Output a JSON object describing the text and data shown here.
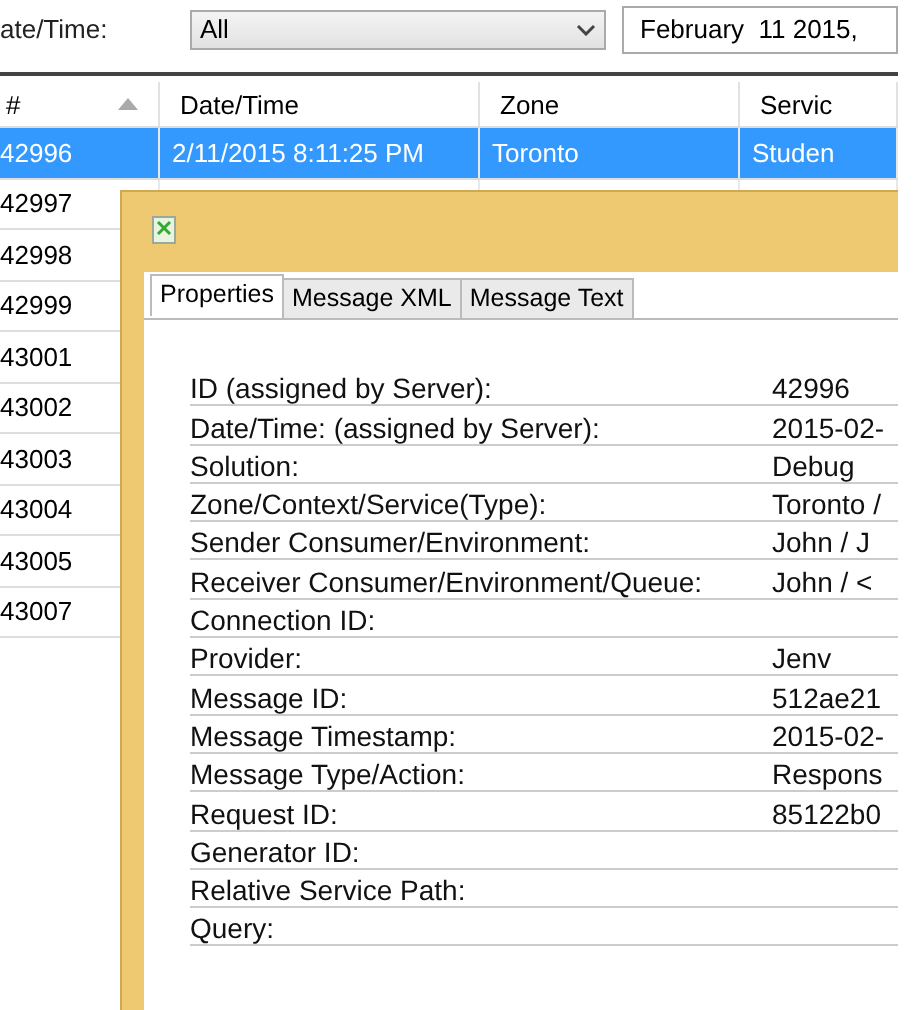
{
  "filter": {
    "label": "ate/Time:",
    "dropdown": "All",
    "date": "February  11 2015,"
  },
  "table": {
    "columns": [
      {
        "label": "#",
        "sorted": true
      },
      {
        "label": "Date/Time",
        "sorted": false
      },
      {
        "label": "Zone",
        "sorted": false
      },
      {
        "label": "Servic",
        "sorted": false
      }
    ],
    "rows": [
      {
        "cells": [
          "42996",
          "2/11/2015 8:11:25 PM",
          "Toronto",
          "Studen"
        ],
        "selected": true
      },
      {
        "cells": [
          "42997"
        ],
        "selected": false
      },
      {
        "cells": [
          "42998"
        ],
        "selected": false
      },
      {
        "cells": [
          "42999"
        ],
        "selected": false
      },
      {
        "cells": [
          "43001"
        ],
        "selected": false
      },
      {
        "cells": [
          "43002"
        ],
        "selected": false
      },
      {
        "cells": [
          "43003"
        ],
        "selected": false
      },
      {
        "cells": [
          "43004"
        ],
        "selected": false
      },
      {
        "cells": [
          "43005"
        ],
        "selected": false
      },
      {
        "cells": [
          "43007"
        ],
        "selected": false
      }
    ]
  },
  "dialog": {
    "tabs": [
      {
        "label": "Properties",
        "selected": true
      },
      {
        "label": "Message XML",
        "selected": false
      },
      {
        "label": "Message Text",
        "selected": false
      }
    ],
    "properties": [
      {
        "label": "ID (assigned by Server):",
        "value": "42996"
      },
      {
        "label": "Date/Time: (assigned by Server):",
        "value": "2015-02-"
      },
      {
        "label": "Solution:",
        "value": "Debug"
      },
      {
        "label": "Zone/Context/Service(Type):",
        "value": "Toronto /"
      },
      {
        "label": "Sender Consumer/Environment:",
        "value": "John / J"
      },
      {
        "label": "Receiver Consumer/Environment/Queue:",
        "value": "John / <"
      },
      {
        "label": "Connection ID:"
      },
      {
        "label": "Provider:",
        "value": "Jenv"
      },
      {
        "label": "Message ID:",
        "value": "512ae21"
      },
      {
        "label": "Message Timestamp:",
        "value": "2015-02-"
      },
      {
        "label": "Message Type/Action:",
        "value": "Respons"
      },
      {
        "label": "Request ID:",
        "value": "85122b0"
      },
      {
        "label": "Generator ID:"
      },
      {
        "label": "Relative Service Path:"
      },
      {
        "label": "Query:"
      }
    ]
  }
}
